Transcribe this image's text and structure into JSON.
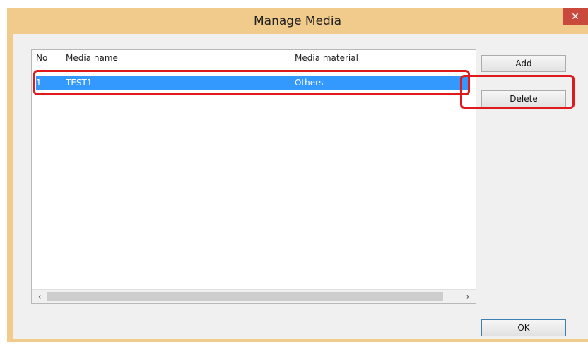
{
  "window": {
    "title": "Manage Media",
    "close_glyph": "✕"
  },
  "listview": {
    "columns": {
      "no": "No",
      "name": "Media name",
      "material": "Media material"
    },
    "rows": [
      {
        "no": "1",
        "name": "TEST1",
        "material": "Others"
      }
    ],
    "scroll_left_glyph": "‹",
    "scroll_right_glyph": "›"
  },
  "buttons": {
    "add": "Add",
    "delete": "Delete",
    "ok": "OK"
  },
  "colors": {
    "frame": "#f1cb8b",
    "selection": "#3399ff",
    "highlight": "#e0191c",
    "close": "#c94a3c"
  }
}
